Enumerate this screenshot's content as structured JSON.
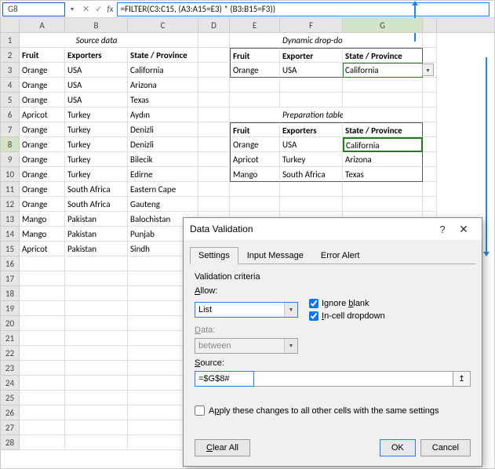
{
  "namebox": "G8",
  "formula": "=FILTER(C3:C15, (A3:A15=E3) * (B3:B15=F3))",
  "columns": [
    "A",
    "B",
    "C",
    "D",
    "E",
    "F",
    "G"
  ],
  "headers": {
    "source_title": "Source data",
    "dyn_title": "Dynamic drop-down",
    "prep_title": "Preparation table",
    "fruit": "Fruit",
    "exporters": "Exporters",
    "exporter": "Exporter",
    "state": "State / Province"
  },
  "source": [
    {
      "fruit": "Orange",
      "exp": "USA",
      "state": "California"
    },
    {
      "fruit": "Orange",
      "exp": "USA",
      "state": "Arizona"
    },
    {
      "fruit": "Orange",
      "exp": "USA",
      "state": "Texas"
    },
    {
      "fruit": "Apricot",
      "exp": "Turkey",
      "state": "Aydın"
    },
    {
      "fruit": "Orange",
      "exp": "Turkey",
      "state": "Denizli"
    },
    {
      "fruit": "Orange",
      "exp": "Turkey",
      "state": "Denizli"
    },
    {
      "fruit": "Orange",
      "exp": "Turkey",
      "state": "Bilecik"
    },
    {
      "fruit": "Orange",
      "exp": "Turkey",
      "state": "Edirne"
    },
    {
      "fruit": "Orange",
      "exp": "South Africa",
      "state": "Eastern Cape"
    },
    {
      "fruit": "Orange",
      "exp": "South Africa",
      "state": "Gauteng"
    },
    {
      "fruit": "Mango",
      "exp": "Pakistan",
      "state": "Balochistan"
    },
    {
      "fruit": "Mango",
      "exp": "Pakistan",
      "state": "Punjab"
    },
    {
      "fruit": "Apricot",
      "exp": "Pakistan",
      "state": "Sindh"
    }
  ],
  "dropdown": {
    "fruit": "Orange",
    "exp": "USA",
    "state": "California"
  },
  "prep": [
    {
      "fruit": "Orange",
      "exp": "USA",
      "state": "California"
    },
    {
      "fruit": "Apricot",
      "exp": "Turkey",
      "state": "Arizona"
    },
    {
      "fruit": "Mango",
      "exp": "South Africa",
      "state": "Texas"
    }
  ],
  "dlg": {
    "title": "Data Validation",
    "tabs": {
      "settings": "Settings",
      "input": "Input Message",
      "error": "Error Alert"
    },
    "criteria": "Validation criteria",
    "allow_lbl": "Allow:",
    "allow_val": "List",
    "data_lbl": "Data:",
    "data_val": "between",
    "ignore": "Ignore blank",
    "incell": "In-cell dropdown",
    "source_lbl": "Source:",
    "source_val": "=$G$8#",
    "apply": "Apply these changes to all other cells with the same settings",
    "clear": "Clear All",
    "ok": "OK",
    "cancel": "Cancel"
  }
}
